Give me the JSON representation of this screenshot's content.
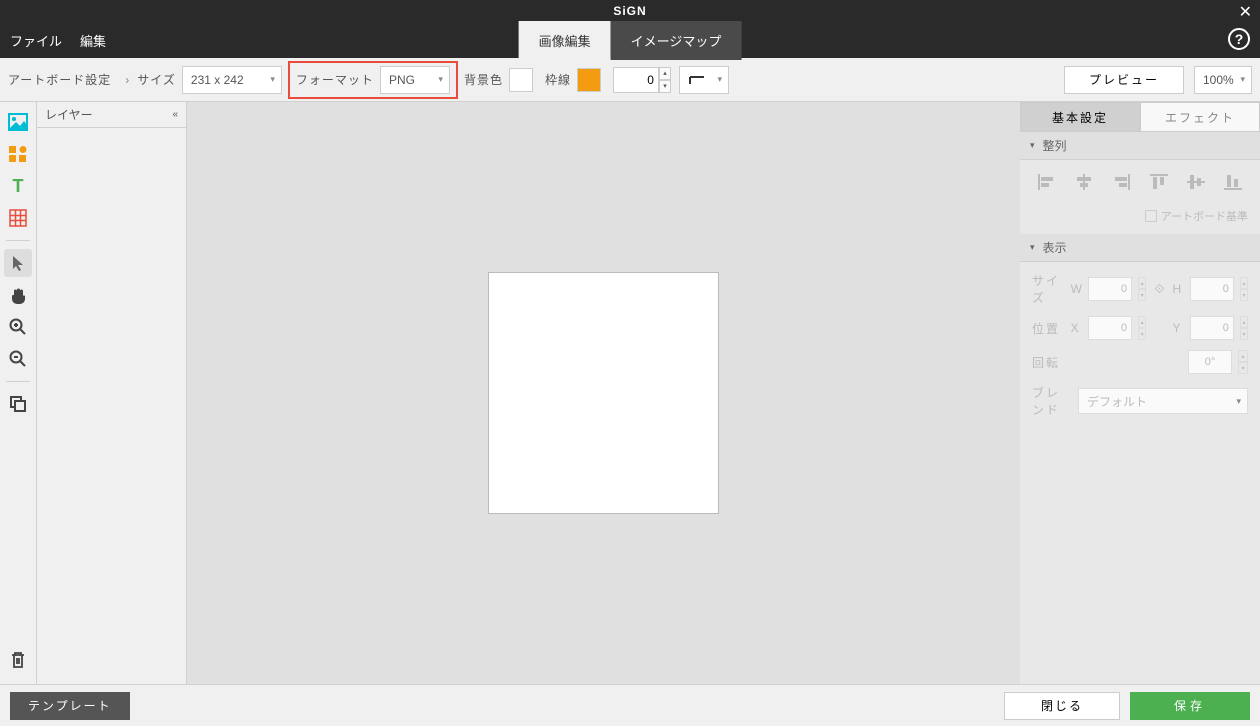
{
  "titlebar": {
    "title": "SiGN"
  },
  "menubar": {
    "file": "ファイル",
    "edit": "編集"
  },
  "tabs": {
    "image_edit": "画像編集",
    "image_map": "イメージマップ"
  },
  "toolbar": {
    "artboard_settings": "アートボード設定",
    "size_label": "サイズ",
    "size_value": "231 x 242",
    "format_label": "フォーマット",
    "format_value": "PNG",
    "bgcolor_label": "背景色",
    "border_label": "枠線",
    "border_value": "0",
    "preview": "プレビュー",
    "zoom": "100%"
  },
  "layer": {
    "title": "レイヤー"
  },
  "rightpanel": {
    "tab_basic": "基本設定",
    "tab_effect": "エフェクト",
    "section_align": "整列",
    "artboard_base": "アートボード基準",
    "section_display": "表示",
    "size_label": "サイズ",
    "w": "W",
    "h": "H",
    "w_val": "0",
    "h_val": "0",
    "pos_label": "位置",
    "x": "X",
    "y": "Y",
    "x_val": "0",
    "y_val": "0",
    "rot_label": "回転",
    "rot_val": "0°",
    "blend_label": "ブレンド",
    "blend_val": "デフォルト"
  },
  "footer": {
    "template": "テンプレート",
    "close": "閉じる",
    "save": "保存"
  }
}
